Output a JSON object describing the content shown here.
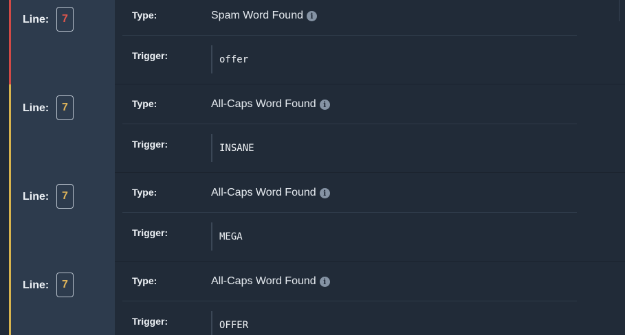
{
  "labels": {
    "line": "Line:",
    "type": "Type:",
    "trigger": "Trigger:"
  },
  "entries": [
    {
      "severity": "spam",
      "line": "7",
      "type": "Spam Word Found",
      "trigger": "offer",
      "accent_color": "#d24a46"
    },
    {
      "severity": "caps",
      "line": "7",
      "type": "All-Caps Word Found",
      "trigger": "INSANE",
      "accent_color": "#d8b44e"
    },
    {
      "severity": "caps",
      "line": "7",
      "type": "All-Caps Word Found",
      "trigger": "MEGA",
      "accent_color": "#d8b44e"
    },
    {
      "severity": "caps",
      "line": "7",
      "type": "All-Caps Word Found",
      "trigger": "OFFER",
      "accent_color": "#d8b44e"
    }
  ],
  "icons": {
    "info": "info-icon"
  }
}
